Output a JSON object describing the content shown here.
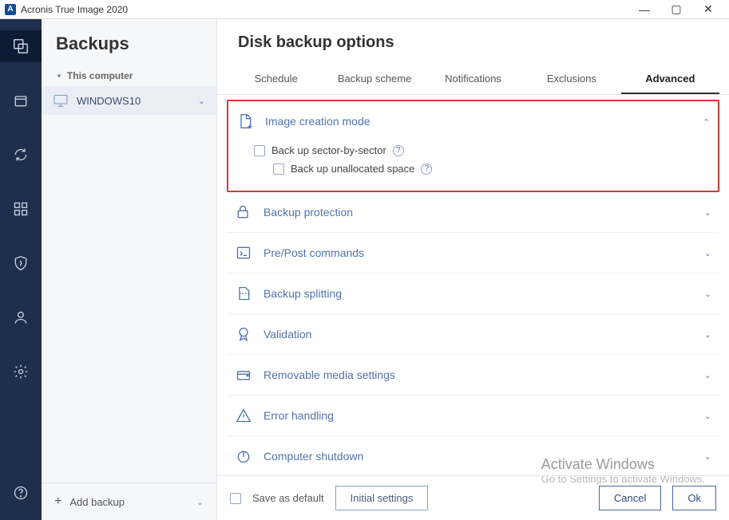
{
  "titlebar": {
    "app_name": "Acronis True Image 2020",
    "app_icon_letter": "A"
  },
  "rail": {
    "items": [
      {
        "name": "backups-icon"
      },
      {
        "name": "archive-icon"
      },
      {
        "name": "sync-icon"
      },
      {
        "name": "apps-icon"
      },
      {
        "name": "protection-icon"
      },
      {
        "name": "account-icon"
      },
      {
        "name": "settings-icon"
      }
    ],
    "help": {
      "name": "help-icon"
    }
  },
  "sidebar": {
    "title": "Backups",
    "tree_head": "This computer",
    "items": [
      {
        "label": "WINDOWS10"
      }
    ],
    "add_label": "Add backup"
  },
  "content": {
    "title": "Disk backup options",
    "tabs": [
      {
        "label": "Schedule",
        "active": false
      },
      {
        "label": "Backup scheme",
        "active": false
      },
      {
        "label": "Notifications",
        "active": false
      },
      {
        "label": "Exclusions",
        "active": false
      },
      {
        "label": "Advanced",
        "active": true
      }
    ],
    "sections": [
      {
        "label": "Image creation mode",
        "expanded": true,
        "checks": [
          {
            "label": "Back up sector-by-sector",
            "indent": false
          },
          {
            "label": "Back up unallocated space",
            "indent": true
          }
        ]
      },
      {
        "label": "Backup protection",
        "expanded": false
      },
      {
        "label": "Pre/Post commands",
        "expanded": false
      },
      {
        "label": "Backup splitting",
        "expanded": false
      },
      {
        "label": "Validation",
        "expanded": false
      },
      {
        "label": "Removable media settings",
        "expanded": false
      },
      {
        "label": "Error handling",
        "expanded": false
      },
      {
        "label": "Computer shutdown",
        "expanded": false
      }
    ],
    "footer": {
      "save_default": "Save as default",
      "initial": "Initial settings",
      "cancel": "Cancel",
      "ok": "Ok"
    }
  },
  "watermark": {
    "title": "Activate Windows",
    "sub": "Go to Settings to activate Windows."
  }
}
